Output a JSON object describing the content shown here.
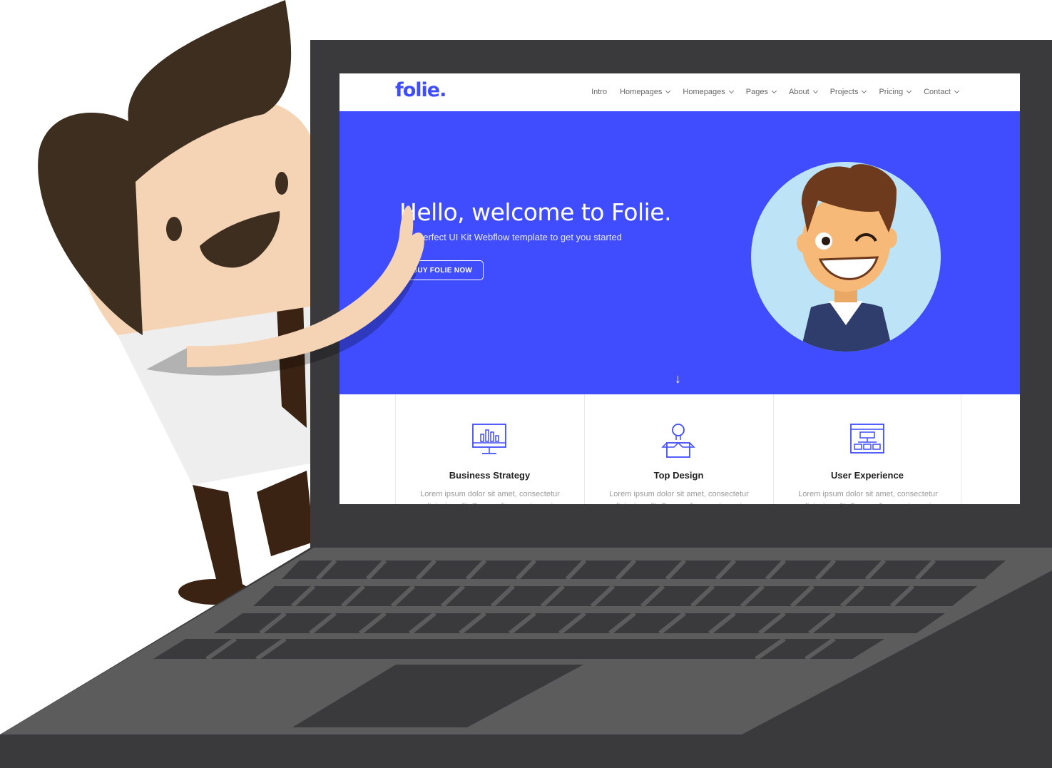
{
  "site": {
    "logo": "folie.",
    "nav": [
      {
        "label": "Intro",
        "dropdown": false
      },
      {
        "label": "Homepages",
        "dropdown": true
      },
      {
        "label": "Homepages",
        "dropdown": true
      },
      {
        "label": "Pages",
        "dropdown": true
      },
      {
        "label": "About",
        "dropdown": true
      },
      {
        "label": "Projects",
        "dropdown": true
      },
      {
        "label": "Pricing",
        "dropdown": true
      },
      {
        "label": "Contact",
        "dropdown": true
      }
    ],
    "hero": {
      "title": "Hello, welcome to Folie.",
      "subtitle": "The perfect UI Kit Webflow template to get you started",
      "button": "BUY FOLIE NOW",
      "arrow": "↓"
    },
    "features": [
      {
        "title": "Business Strategy",
        "text": "Lorem ipsum dolor sit amet, consectetur adipiscing elit. Suspendisse varius enim",
        "icon": "chart-monitor-icon"
      },
      {
        "title": "Top Design",
        "text": "Lorem ipsum dolor sit amet, consectetur adipiscing elit. Suspendisse varius enim",
        "icon": "lightbulb-box-icon"
      },
      {
        "title": "User Experience",
        "text": "Lorem ipsum dolor sit amet, consectetur adipiscing elit. Suspendisse varius enim",
        "icon": "sitemap-window-icon"
      }
    ]
  },
  "colors": {
    "brand": "#3f4dfe",
    "laptop_body": "#3a3a3c",
    "keyboard_deck": "#5c5c5c"
  }
}
